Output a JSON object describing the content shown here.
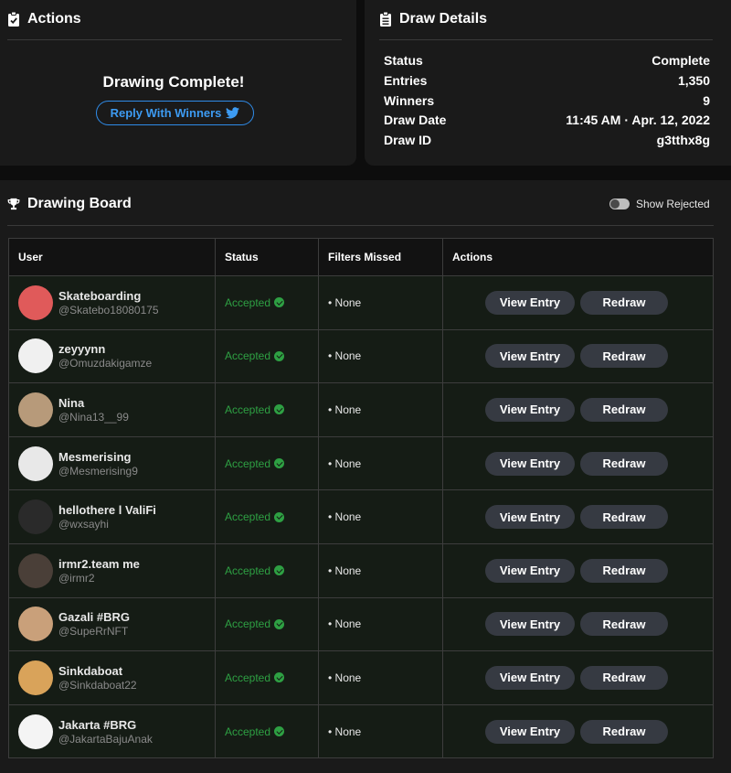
{
  "actions_panel": {
    "title": "Actions",
    "complete_text": "Drawing Complete!",
    "reply_button": "Reply With Winners"
  },
  "details_panel": {
    "title": "Draw Details",
    "rows": [
      {
        "label": "Status",
        "value": "Complete"
      },
      {
        "label": "Entries",
        "value": "1,350"
      },
      {
        "label": "Winners",
        "value": "9"
      },
      {
        "label": "Draw Date",
        "value": "11:45 AM · Apr. 12, 2022"
      },
      {
        "label": "Draw ID",
        "value": "g3tthx8g"
      }
    ]
  },
  "board": {
    "title": "Drawing Board",
    "toggle_label": "Show Rejected",
    "columns": [
      "User",
      "Status",
      "Filters Missed",
      "Actions"
    ],
    "view_label": "View Entry",
    "redraw_label": "Redraw",
    "entries": [
      {
        "name": "Skateboarding",
        "handle": "@Skatebo18080175",
        "status": "Accepted",
        "filters": "• None",
        "avatar_color": "#e05a5a"
      },
      {
        "name": "zeyyynn",
        "handle": "@Omuzdakigamze",
        "status": "Accepted",
        "filters": "• None",
        "avatar_color": "#f0f0f0"
      },
      {
        "name": "Nina",
        "handle": "@Nina13__99",
        "status": "Accepted",
        "filters": "• None",
        "avatar_color": "#b79a7a"
      },
      {
        "name": "Mesmerising",
        "handle": "@Mesmerising9",
        "status": "Accepted",
        "filters": "• None",
        "avatar_color": "#e8e8e8"
      },
      {
        "name": "hellothere l ValiFi",
        "handle": "@wxsayhi",
        "status": "Accepted",
        "filters": "• None",
        "avatar_color": "#2a2a2a"
      },
      {
        "name": "irmr2.team me",
        "handle": "@irmr2",
        "status": "Accepted",
        "filters": "• None",
        "avatar_color": "#4a3f38"
      },
      {
        "name": "Gazali #BRG",
        "handle": "@SupeRrNFT",
        "status": "Accepted",
        "filters": "• None",
        "avatar_color": "#c9a07a"
      },
      {
        "name": "Sinkdaboat",
        "handle": "@Sinkdaboat22",
        "status": "Accepted",
        "filters": "• None",
        "avatar_color": "#d9a35a"
      },
      {
        "name": "Jakarta #BRG",
        "handle": "@JakartaBajuAnak",
        "status": "Accepted",
        "filters": "• None",
        "avatar_color": "#f4f4f4"
      }
    ]
  },
  "colors": {
    "accent_blue": "#2f8be8",
    "accepted_green": "#2ea043"
  }
}
